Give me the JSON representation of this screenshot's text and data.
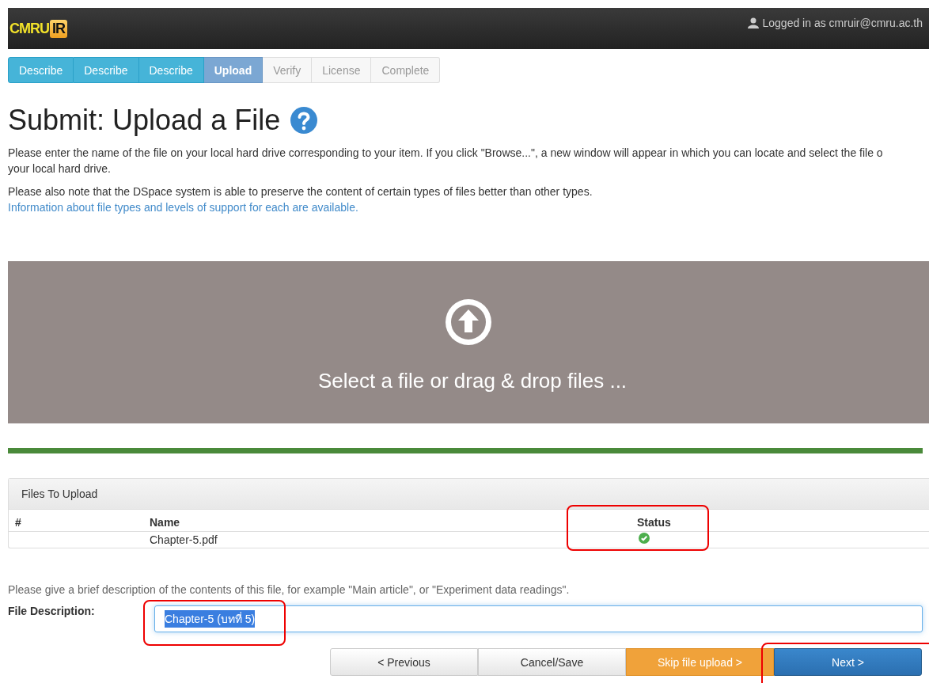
{
  "header": {
    "logo_text": "CMRU",
    "logo_badge": "IR",
    "user": "Logged in as cmruir@cmru.ac.th"
  },
  "steps": [
    {
      "label": "Describe",
      "completed": true,
      "selected": false
    },
    {
      "label": "Describe",
      "completed": true,
      "selected": false
    },
    {
      "label": "Describe",
      "completed": true,
      "selected": false
    },
    {
      "label": "Upload",
      "completed": false,
      "selected": true
    },
    {
      "label": "Verify",
      "completed": false,
      "selected": false
    },
    {
      "label": "License",
      "completed": false,
      "selected": false
    },
    {
      "label": "Complete",
      "completed": false,
      "selected": false
    }
  ],
  "title": "Submit: Upload a File",
  "intro_lines": [
    "Please enter the name of the file on your local hard drive corresponding to your item. If you click \"Browse...\", a new window will appear in which you can locate and select the file o",
    "your local hard drive."
  ],
  "note": "Please also note that the DSpace system is able to preserve the content of certain types of files better than other types.",
  "note_link": "Information about file types and levels of support for each are available.",
  "dropzone": {
    "text": "Select a file or drag & drop files ..."
  },
  "files_panel": {
    "title": "Files To Upload",
    "columns": [
      "#",
      "Name",
      "Status"
    ],
    "rows": [
      {
        "name": "Chapter-5.pdf",
        "uploaded": true
      }
    ]
  },
  "description_hint": "Please give a brief description of the contents of this file, for example \"Main article\", or \"Experiment data readings\".",
  "description_field": {
    "label": "File Description:",
    "value": "Chapter-5 (บทที่ 5)",
    "selected": true
  },
  "buttons": [
    {
      "label": "< Previous",
      "kind": "default"
    },
    {
      "label": "Cancel/Save",
      "kind": "default"
    },
    {
      "label": "Skip file upload >",
      "kind": "warning"
    },
    {
      "label": "Next >",
      "kind": "primary"
    }
  ]
}
